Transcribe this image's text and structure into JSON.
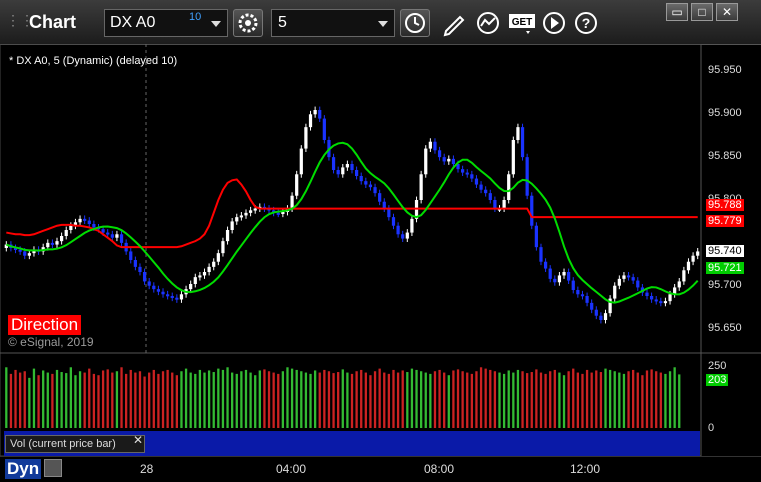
{
  "app": {
    "title": "Chart",
    "symbol": "DX A0",
    "delay_badge": "10",
    "interval": "5"
  },
  "icons": [
    "grip-icon",
    "gear-icon",
    "clock-icon",
    "pencil-icon",
    "line-study-icon",
    "get-icon",
    "play-icon",
    "help-icon",
    "restore-icon",
    "maximize-icon",
    "close-icon"
  ],
  "legend": "* DX A0, 5 (Dynamic) (delayed 10)",
  "overlay": {
    "direction_label": "Direction",
    "copyright": "© eSignal, 2019"
  },
  "price_axis": {
    "ticks": [
      "95.950",
      "95.900",
      "95.850",
      "95.800",
      "95.700",
      "95.650"
    ],
    "tick_values": [
      95.95,
      95.9,
      95.85,
      95.8,
      95.7,
      95.65
    ],
    "ylim": [
      95.625,
      95.975
    ],
    "badges": [
      {
        "text": "95.788",
        "value": 95.788,
        "bg": "#ff0000",
        "fg": "#ffffff"
      },
      {
        "text": "95.779",
        "value": 95.779,
        "bg": "#ff0000",
        "fg": "#ffffff"
      },
      {
        "text": "95.740",
        "value": 95.74,
        "bg": "#ffffff",
        "fg": "#000000"
      },
      {
        "text": "95.721",
        "value": 95.721,
        "bg": "#00cc00",
        "fg": "#ffffff"
      }
    ]
  },
  "volume_axis": {
    "ticks": [
      "250",
      "0"
    ],
    "badge": {
      "text": "203",
      "bg": "#00cc00",
      "fg": "#ffffff"
    },
    "legend": "Vol (current price bar)"
  },
  "bottom_bar": {
    "mode": "Dyn",
    "time_labels": [
      "28",
      "04:00",
      "08:00",
      "12:00"
    ]
  },
  "colors": {
    "up_candle": "#ffffff",
    "down_candle": "#1a33ff",
    "red_line": "#ff0000",
    "green_line": "#00dd00",
    "vol_up": "#33bb33",
    "vol_down": "#cc2222"
  },
  "chart_data": {
    "type": "line",
    "series_desc": "OHLC candlesticks with moving averages and volume",
    "ylim": [
      95.625,
      95.975
    ],
    "closes": [
      95.748,
      95.744,
      95.742,
      95.74,
      95.735,
      95.738,
      95.742,
      95.74,
      95.745,
      95.75,
      95.748,
      95.752,
      95.758,
      95.765,
      95.77,
      95.774,
      95.778,
      95.776,
      95.772,
      95.768,
      95.766,
      95.762,
      95.76,
      95.756,
      95.76,
      95.75,
      95.74,
      95.73,
      95.722,
      95.716,
      95.705,
      95.7,
      95.696,
      95.693,
      95.69,
      95.688,
      95.686,
      95.684,
      95.69,
      95.696,
      95.702,
      95.71,
      95.712,
      95.716,
      95.722,
      95.728,
      95.738,
      95.752,
      95.765,
      95.775,
      95.78,
      95.782,
      95.785,
      95.788,
      95.79,
      95.792,
      95.79,
      95.788,
      95.785,
      95.784,
      95.786,
      95.79,
      95.805,
      95.83,
      95.86,
      95.885,
      95.9,
      95.905,
      95.895,
      95.87,
      95.85,
      95.835,
      95.83,
      95.838,
      95.842,
      95.835,
      95.828,
      95.822,
      95.818,
      95.815,
      95.808,
      95.798,
      95.79,
      95.78,
      95.77,
      95.76,
      95.755,
      95.762,
      95.778,
      95.8,
      95.83,
      95.86,
      95.868,
      95.858,
      95.85,
      95.845,
      95.848,
      95.842,
      95.836,
      95.832,
      95.83,
      95.825,
      95.818,
      95.812,
      95.808,
      95.8,
      95.79,
      95.79,
      95.8,
      95.83,
      95.87,
      95.885,
      95.85,
      95.805,
      95.77,
      95.745,
      95.728,
      95.72,
      95.708,
      95.704,
      95.712,
      95.716,
      95.706,
      95.695,
      95.69,
      95.688,
      95.68,
      95.672,
      95.665,
      95.66,
      95.668,
      95.685,
      95.7,
      95.708,
      95.712,
      95.71,
      95.706,
      95.698,
      95.692,
      95.688,
      95.684,
      95.682,
      95.68,
      95.682,
      95.69,
      95.698,
      95.705,
      95.718,
      95.728,
      95.735,
      95.74
    ],
    "red_ma": [
      95.762,
      95.761,
      95.76,
      95.76,
      95.759,
      95.759,
      95.76,
      95.762,
      95.764,
      95.766,
      95.768,
      95.77,
      95.771,
      95.771,
      95.771,
      95.77,
      95.77,
      95.769,
      95.768,
      95.766,
      95.764,
      95.76,
      95.756,
      95.752,
      95.747,
      95.745,
      95.745,
      95.745,
      95.745,
      95.745,
      95.745,
      95.745,
      95.745,
      95.745,
      95.745,
      95.745,
      95.745,
      95.745,
      95.746,
      95.748,
      95.75,
      95.752,
      95.755,
      95.76,
      95.77,
      95.785,
      95.8,
      95.812,
      95.82,
      95.823,
      95.824,
      95.818,
      95.81,
      95.8,
      95.792,
      95.79,
      95.79,
      95.79,
      95.79,
      95.79,
      95.79,
      95.79,
      95.79,
      95.79,
      95.79,
      95.79,
      95.79,
      95.79,
      95.79,
      95.79,
      95.79,
      95.79,
      95.79,
      95.79,
      95.79,
      95.79,
      95.79,
      95.79,
      95.79,
      95.79,
      95.79,
      95.79,
      95.79,
      95.79,
      95.79,
      95.79,
      95.79,
      95.79,
      95.79,
      95.79,
      95.79,
      95.79,
      95.79,
      95.79,
      95.79,
      95.79,
      95.79,
      95.79,
      95.79,
      95.79,
      95.79,
      95.79,
      95.79,
      95.79,
      95.79,
      95.79,
      95.79,
      95.79,
      95.79,
      95.79,
      95.79,
      95.79,
      95.79,
      95.79,
      95.78,
      95.78,
      95.78,
      95.78,
      95.78,
      95.78,
      95.78,
      95.78,
      95.78,
      95.78,
      95.78,
      95.78,
      95.78,
      95.78,
      95.78,
      95.78,
      95.78,
      95.78,
      95.78,
      95.78,
      95.78,
      95.78,
      95.78,
      95.78,
      95.78,
      95.78,
      95.78,
      95.78,
      95.78,
      95.78,
      95.78,
      95.78,
      95.78,
      95.78,
      95.78,
      95.78,
      95.78
    ],
    "volume_ylim": [
      0,
      250
    ],
    "volumes": [
      230,
      205,
      220,
      210,
      215,
      190,
      225,
      200,
      218,
      210,
      205,
      220,
      212,
      208,
      230,
      200,
      215,
      210,
      225,
      205,
      200,
      218,
      222,
      210,
      215,
      230,
      205,
      220,
      210,
      215,
      195,
      210,
      220,
      205,
      215,
      220,
      210,
      200,
      215,
      225,
      210,
      205,
      220,
      210,
      218,
      212,
      225,
      220,
      230,
      210,
      205,
      215,
      220,
      210,
      200,
      218,
      222,
      215,
      210,
      205,
      215,
      230,
      225,
      220,
      215,
      210,
      205,
      218,
      210,
      220,
      215,
      208,
      212,
      222,
      210,
      205,
      215,
      220,
      210,
      200,
      215,
      225,
      210,
      205,
      220,
      210,
      218,
      212,
      225,
      220,
      215,
      210,
      205,
      215,
      220,
      210,
      200,
      218,
      222,
      215,
      210,
      205,
      215,
      230,
      225,
      220,
      215,
      210,
      205,
      218,
      210,
      220,
      215,
      208,
      212,
      222,
      210,
      205,
      215,
      220,
      210,
      200,
      215,
      225,
      210,
      205,
      220,
      210,
      218,
      212,
      225,
      220,
      215,
      210,
      205,
      215,
      220,
      210,
      200,
      218,
      222,
      215,
      210,
      205,
      215,
      230,
      203
    ]
  }
}
